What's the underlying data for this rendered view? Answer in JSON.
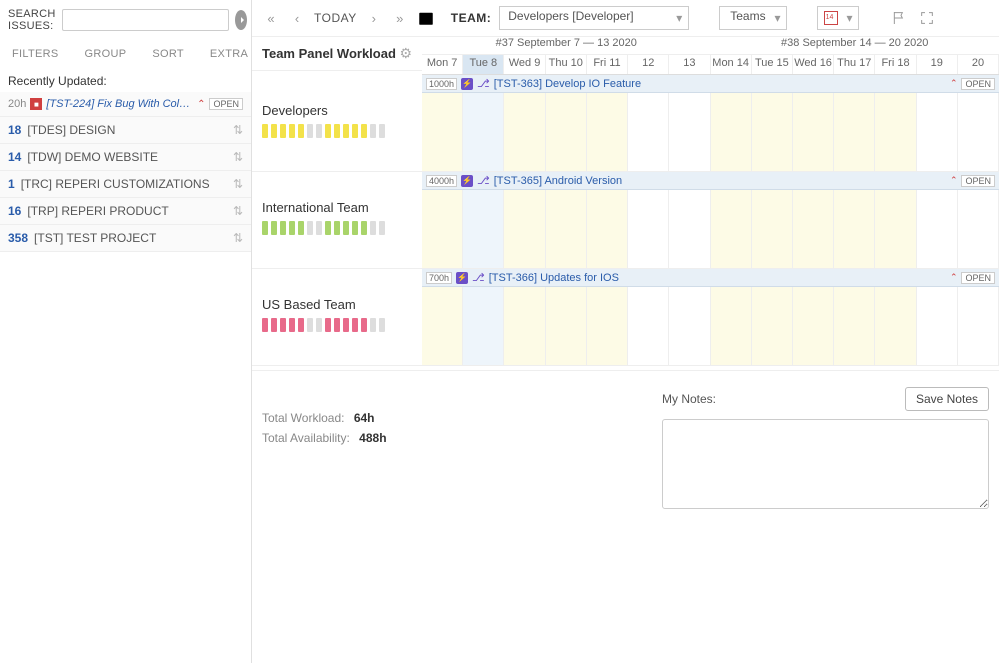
{
  "sidebar": {
    "search_label": "SEARCH ISSUES:",
    "search_value": "",
    "filters": [
      "FILTERS",
      "GROUP",
      "SORT",
      "EXTRA"
    ],
    "recent_label": "Recently Updated:",
    "recent_issue": {
      "hours": "20h",
      "title": "[TST-224] Fix Bug With Colo…",
      "status": "OPEN"
    },
    "projects": [
      {
        "count": "18",
        "name": "[TDES] DESIGN"
      },
      {
        "count": "14",
        "name": "[TDW] DEMO WEBSITE"
      },
      {
        "count": "1",
        "name": "[TRC] REPERI CUSTOMIZATIONS"
      },
      {
        "count": "16",
        "name": "[TRP] REPERI PRODUCT"
      },
      {
        "count": "358",
        "name": "[TST] TEST PROJECT"
      }
    ]
  },
  "toolbar": {
    "today": "TODAY",
    "team_label": "TEAM:",
    "team_selected": "Developers [Developer]",
    "teams_btn": "Teams"
  },
  "panel": {
    "title": "Team Panel Workload",
    "weeks": [
      "#37 September 7 — 13 2020",
      "#38 September 14 — 20 2020"
    ],
    "days": [
      "Mon 7",
      "Tue 8",
      "Wed 9",
      "Thu 10",
      "Fri 11",
      "12",
      "13",
      "Mon 14",
      "Tue 15",
      "Wed 16",
      "Thu 17",
      "Fri 18",
      "19",
      "20"
    ],
    "active_day_index": 1,
    "teams": [
      {
        "name": "Developers",
        "bar_color": "#f3e24a",
        "bars": [
          1,
          1,
          1,
          1,
          1,
          0,
          0,
          1,
          1,
          1,
          1,
          1,
          0,
          0
        ],
        "task": {
          "hours": "1000h",
          "title": "[TST-363] Develop IO Feature",
          "status": "OPEN"
        }
      },
      {
        "name": "International Team",
        "bar_color": "#a9d46a",
        "bars": [
          1,
          1,
          1,
          1,
          1,
          0,
          0,
          1,
          1,
          1,
          1,
          1,
          0,
          0
        ],
        "task": {
          "hours": "4000h",
          "title": "[TST-365] Android Version",
          "status": "OPEN"
        }
      },
      {
        "name": "US Based Team",
        "bar_color": "#e86a8a",
        "bars": [
          1,
          1,
          1,
          1,
          1,
          0,
          0,
          1,
          1,
          1,
          1,
          1,
          0,
          0
        ],
        "task": {
          "hours": "700h",
          "title": "[TST-366] Updates for IOS",
          "status": "OPEN"
        }
      }
    ]
  },
  "footer": {
    "total_workload_label": "Total Workload:",
    "total_workload": "64h",
    "total_avail_label": "Total Availability:",
    "total_avail": "488h",
    "notes_label": "My Notes:",
    "save_label": "Save Notes",
    "notes_value": ""
  }
}
